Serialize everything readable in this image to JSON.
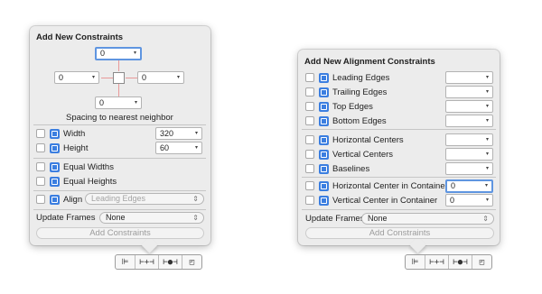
{
  "left_panel": {
    "title": "Add New Constraints",
    "spacing_top": "0",
    "spacing_left": "0",
    "spacing_right": "0",
    "spacing_bottom": "0",
    "spacing_caption": "Spacing to nearest neighbor",
    "width_label": "Width",
    "width_value": "320",
    "height_label": "Height",
    "height_value": "60",
    "equal_widths_label": "Equal Widths",
    "equal_heights_label": "Equal Heights",
    "align_label": "Align",
    "align_value": "Leading Edges",
    "update_frames_label": "Update Frames",
    "update_frames_value": "None",
    "add_button": "Add Constraints"
  },
  "right_panel": {
    "title": "Add New Alignment Constraints",
    "rows": [
      {
        "label": "Leading Edges",
        "value": ""
      },
      {
        "label": "Trailing Edges",
        "value": ""
      },
      {
        "label": "Top Edges",
        "value": ""
      },
      {
        "label": "Bottom Edges",
        "value": ""
      },
      {
        "label": "Horizontal Centers",
        "value": ""
      },
      {
        "label": "Vertical Centers",
        "value": ""
      },
      {
        "label": "Baselines",
        "value": ""
      },
      {
        "label": "Horizontal Center in Container",
        "value": "0"
      },
      {
        "label": "Vertical Center in Container",
        "value": "0"
      }
    ],
    "update_frames_label": "Update Frames",
    "update_frames_value": "None",
    "add_button": "Add Constraints"
  },
  "toolbar": {
    "align_glyph": "⊫",
    "pin_glyph": "⊢+⊣",
    "resolve_glyph": "⊢●⊣",
    "resize_glyph": "◰"
  },
  "icons": {
    "caret": "▾",
    "stepper": "⇕"
  },
  "colors": {
    "accent": "#3b7ee0",
    "strut": "#e89999",
    "focus": "#5f95e0"
  }
}
